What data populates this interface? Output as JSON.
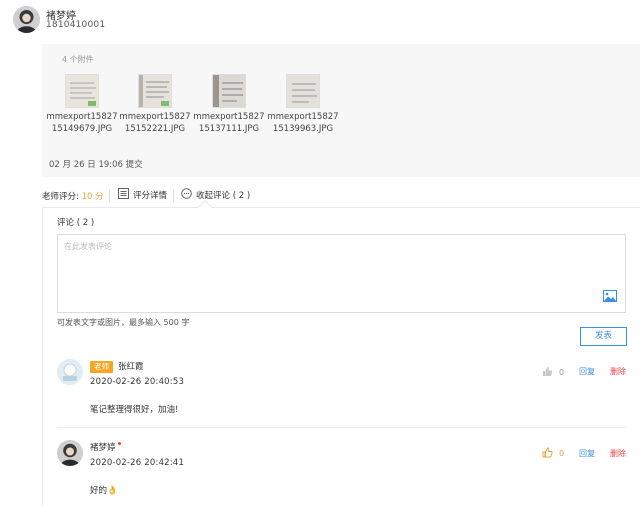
{
  "user": {
    "name": "褚梦婷",
    "id": "1810410001"
  },
  "attachments": {
    "count_label": "4 个附件",
    "files": [
      {
        "name_line1": "mmexport15827",
        "name_line2": "15149679.JPG"
      },
      {
        "name_line1": "mmexport15827",
        "name_line2": "15152221.JPG"
      },
      {
        "name_line1": "mmexport15827",
        "name_line2": "15137111.JPG"
      },
      {
        "name_line1": "mmexport15827",
        "name_line2": "15139963.JPG"
      }
    ],
    "submit_time": "02 月 26 日 19:06 提交"
  },
  "grading": {
    "score_label": "老师评分:",
    "score_value": "10 分",
    "score_detail_label": "评分详情",
    "collapse_comments_label": "收起评论 ( 2 )"
  },
  "comments": {
    "heading": "评论 ( 2 )",
    "placeholder": "在此发表评论",
    "hint": "可发表文字或图片，最多输入 500 字",
    "publish_label": "发表",
    "items": [
      {
        "tag": "老师",
        "author": "张红霞",
        "time": "2020-02-26 20:40:53",
        "text": "笔记整理得很好，加油!",
        "likes": "0",
        "reply_label": "回复",
        "delete_label": "删除"
      },
      {
        "author": "褚梦婷",
        "time": "2020-02-26 20:42:41",
        "text": "好的👌",
        "likes": "0",
        "reply_label": "回复",
        "delete_label": "删除"
      }
    ]
  },
  "colors": {
    "accent": "#3a8ee6",
    "score": "#e6a23c",
    "tag": "#f5a623",
    "delete": "#e64545"
  },
  "icons": [
    "avatar",
    "image-thumbnail",
    "list-icon",
    "comment-icon",
    "insert-image-icon",
    "thumbs-up-icon"
  ]
}
